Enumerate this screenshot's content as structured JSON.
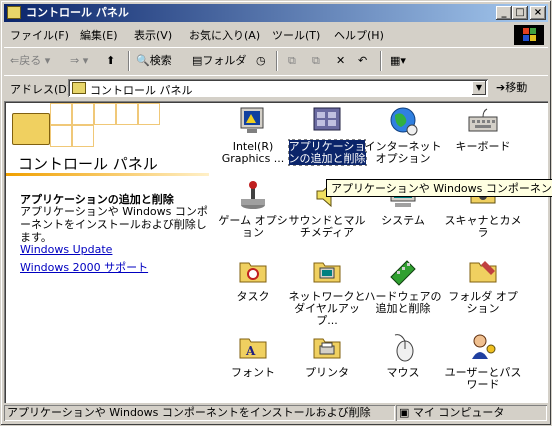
{
  "window": {
    "title": "コントロール パネル",
    "btn_min": "_",
    "btn_max": "□",
    "btn_close": "×"
  },
  "menu": [
    "ファイル(F)",
    "編集(E)",
    "表示(V)",
    "お気に入り(A)",
    "ツール(T)",
    "ヘルプ(H)"
  ],
  "toolbar": {
    "back": "戻る",
    "search": "検索",
    "folders": "フォルダ"
  },
  "address": {
    "label": "アドレス(D)",
    "value": "コントロール パネル",
    "go_label": "移動"
  },
  "left_pane": {
    "title": "コントロール パネル",
    "selected_title": "アプリケーションの追加と削除",
    "selected_desc": "アプリケーションや Windows コンポーネントをインストールおよび削除します。",
    "links": [
      "Windows Update",
      "Windows 2000 サポート"
    ]
  },
  "items": [
    {
      "label": "Intel(R) Graphics ...",
      "icon": "monitor-icon"
    },
    {
      "label": "アプリケーションの追加と削除",
      "icon": "add-remove-programs-icon",
      "selected": true
    },
    {
      "label": "インターネット オプション",
      "icon": "globe-icon"
    },
    {
      "label": "キーボード",
      "icon": "keyboard-icon"
    },
    {
      "label": "ゲーム オプション",
      "icon": "joystick-icon"
    },
    {
      "label": "サウンドとマルチメディア",
      "icon": "speaker-icon"
    },
    {
      "label": "システム",
      "icon": "computer-icon"
    },
    {
      "label": "スキャナとカメラ",
      "icon": "scanner-camera-icon"
    },
    {
      "label": "タスク",
      "icon": "task-folder-icon"
    },
    {
      "label": "ネットワークとダイヤルアップ...",
      "icon": "network-icon"
    },
    {
      "label": "ハードウェアの追加と削除",
      "icon": "hardware-icon"
    },
    {
      "label": "フォルダ オプション",
      "icon": "folder-options-icon"
    },
    {
      "label": "フォント",
      "icon": "fonts-folder-icon"
    },
    {
      "label": "プリンタ",
      "icon": "printer-folder-icon"
    },
    {
      "label": "マウス",
      "icon": "mouse-icon"
    },
    {
      "label": "ユーザーとパスワード",
      "icon": "users-passwords-icon"
    }
  ],
  "tooltip": "アプリケーションや Windows コンポーネントをインストールおよび削除します。",
  "status": {
    "text": "アプリケーションや Windows コンポーネントをインストールおよび削除",
    "zone": "マイ コンピュータ"
  }
}
